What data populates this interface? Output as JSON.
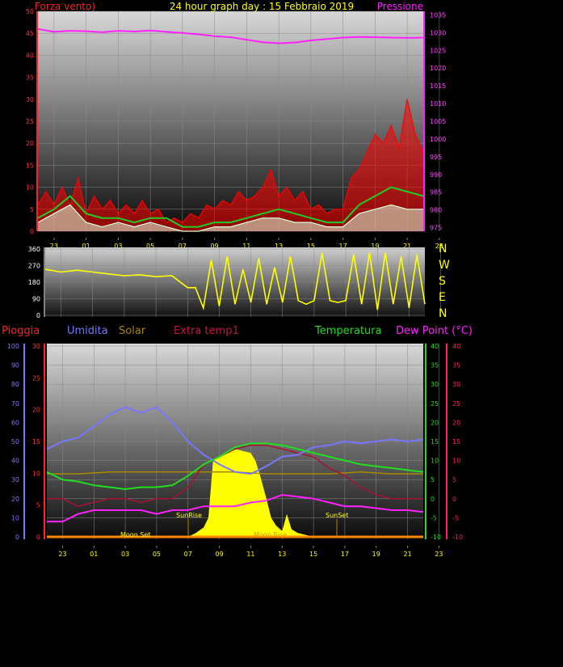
{
  "header": {
    "left_title": "Forza vento)",
    "center_title": "24 hour graph day : 15 Febbraio 2019",
    "right_title": "Pressione"
  },
  "compass": [
    "N",
    "W",
    "S",
    "E",
    "N"
  ],
  "legend": {
    "pioggia": "Pioggia",
    "umidita": "Umidita",
    "solar": "Solar",
    "extra": "Extra temp1",
    "temperatura": "Temperatura",
    "dewpoint": "Dew Point (°C)"
  },
  "annotations": {
    "sunrise": "SunRise",
    "sunset": "SunSet",
    "moonset": "Moon Set",
    "moonrise": "Moon Rise"
  },
  "colors": {
    "wind_gust": "#ff0000",
    "wind_avg": "#22cc22",
    "wind_speed": "#ddffdd",
    "pressure": "#ff22ff",
    "direction": "#ffff00",
    "humidity": "#7777ff",
    "temperature": "#22dd22",
    "dewpoint": "#ff22ff",
    "extra_temp": "#aa1133",
    "solar": "#ffff00",
    "solar_ref": "#aa8800",
    "rain": "#ff8800"
  },
  "chart_data": [
    {
      "type": "line",
      "name": "wind-pressure",
      "x_ticks": [
        "23",
        "01",
        "03",
        "05",
        "07",
        "09",
        "11",
        "13",
        "15",
        "17",
        "19",
        "21",
        "23"
      ],
      "y_left_ticks": [
        0,
        5,
        10,
        15,
        20,
        25,
        30,
        35,
        40,
        45,
        50
      ],
      "y_left_lim": [
        0,
        50
      ],
      "y_right_ticks": [
        975,
        980,
        985,
        990,
        995,
        1000,
        1005,
        1010,
        1015,
        1020,
        1025,
        1030,
        1035
      ],
      "y_right_lim": [
        974,
        1036
      ],
      "x_lim": [
        0,
        24
      ],
      "series": [
        {
          "key": "pressure",
          "axis": "right",
          "x": [
            0,
            1,
            2,
            3,
            4,
            5,
            6,
            7,
            8,
            9,
            10,
            11,
            12,
            13,
            14,
            15,
            16,
            17,
            18,
            19,
            20,
            21,
            22,
            23,
            24
          ],
          "values": [
            1031,
            1030.2,
            1030.5,
            1030.4,
            1030.1,
            1030.5,
            1030.3,
            1030.6,
            1030.2,
            1029.9,
            1029.5,
            1029,
            1028.7,
            1028,
            1027.3,
            1027,
            1027.2,
            1027.8,
            1028.2,
            1028.6,
            1028.8,
            1028.7,
            1028.6,
            1028.5,
            1028.6
          ]
        },
        {
          "key": "wind_gust",
          "axis": "left",
          "x": [
            0,
            0.5,
            1,
            1.5,
            2,
            2.5,
            3,
            3.5,
            4,
            4.5,
            5,
            5.5,
            6,
            6.5,
            7,
            7.5,
            8,
            8.5,
            9,
            9.5,
            10,
            10.5,
            11,
            11.5,
            12,
            12.5,
            13,
            13.5,
            14,
            14.5,
            15,
            15.5,
            16,
            16.5,
            17,
            17.5,
            18,
            18.5,
            19,
            19.5,
            20,
            20.5,
            21,
            21.5,
            22,
            22.5,
            23,
            23.5,
            24
          ],
          "values": [
            6,
            9,
            6,
            10,
            6,
            12,
            4,
            8,
            5,
            7,
            4,
            6,
            4,
            7,
            4,
            5,
            2,
            3,
            2,
            4,
            3,
            6,
            5,
            7,
            6,
            9,
            7,
            8,
            10,
            14,
            8,
            10,
            7,
            9,
            5,
            6,
            4,
            5,
            5,
            12,
            14,
            18,
            22,
            20,
            24,
            19,
            30,
            22,
            18
          ]
        },
        {
          "key": "wind_avg",
          "axis": "left",
          "x": [
            0,
            1,
            2,
            3,
            4,
            5,
            6,
            7,
            8,
            9,
            10,
            11,
            12,
            13,
            14,
            15,
            16,
            17,
            18,
            19,
            20,
            21,
            22,
            23,
            24
          ],
          "values": [
            3,
            5,
            8,
            4,
            3,
            3,
            2,
            3,
            3,
            1,
            1,
            2,
            2,
            3,
            4,
            5,
            4,
            3,
            2,
            2,
            6,
            8,
            10,
            9,
            8
          ]
        },
        {
          "key": "wind_speed",
          "axis": "left",
          "x": [
            0,
            1,
            2,
            3,
            4,
            5,
            6,
            7,
            8,
            9,
            10,
            11,
            12,
            13,
            14,
            15,
            16,
            17,
            18,
            19,
            20,
            21,
            22,
            23,
            24
          ],
          "values": [
            2,
            4,
            6,
            2,
            1,
            2,
            1,
            2,
            1,
            0,
            0,
            1,
            1,
            2,
            3,
            3,
            2,
            2,
            1,
            1,
            4,
            5,
            6,
            5,
            5
          ]
        }
      ]
    },
    {
      "type": "line",
      "name": "wind-direction",
      "x_ticks": [
        "23",
        "01",
        "03",
        "05",
        "07",
        "09",
        "11",
        "13",
        "15",
        "17",
        "19",
        "21",
        "23"
      ],
      "y_ticks": [
        0,
        90,
        180,
        270,
        360
      ],
      "y_lim": [
        0,
        360
      ],
      "x_lim": [
        0,
        24
      ],
      "series": [
        {
          "key": "direction",
          "x": [
            0,
            1,
            2,
            3,
            4,
            5,
            6,
            7,
            8,
            9,
            9.5,
            10,
            10.5,
            11,
            11.5,
            12,
            12.5,
            13,
            13.5,
            14,
            14.5,
            15,
            15.5,
            16,
            16.5,
            17,
            17.5,
            18,
            18.5,
            19,
            19.5,
            20,
            20.5,
            21,
            21.5,
            22,
            22.5,
            23,
            23.5,
            24
          ],
          "values": [
            250,
            235,
            245,
            235,
            225,
            215,
            220,
            210,
            215,
            150,
            150,
            40,
            300,
            50,
            320,
            60,
            250,
            70,
            310,
            60,
            260,
            70,
            320,
            80,
            60,
            80,
            340,
            80,
            70,
            80,
            330,
            60,
            340,
            30,
            340,
            60,
            320,
            40,
            330,
            60
          ]
        }
      ]
    },
    {
      "type": "line",
      "name": "weather-multi",
      "x_ticks": [
        "23",
        "01",
        "03",
        "05",
        "07",
        "09",
        "11",
        "13",
        "15",
        "17",
        "19",
        "21",
        "23"
      ],
      "y_left1_ticks": [
        0,
        10,
        20,
        30,
        40,
        50,
        60,
        70,
        80,
        90,
        100
      ],
      "y_left1_lim": [
        0,
        100
      ],
      "y_left2_ticks": [
        0,
        5,
        10,
        15,
        20,
        25,
        30
      ],
      "y_left2_lim": [
        0,
        30
      ],
      "y_right1_ticks": [
        -10,
        -5,
        0,
        5,
        10,
        15,
        20,
        25,
        30,
        35,
        40
      ],
      "y_right1_lim": [
        -10,
        40
      ],
      "y_right2_ticks": [
        -10,
        -5,
        0,
        5,
        10,
        15,
        20,
        25,
        30,
        35,
        40
      ],
      "y_right2_lim": [
        -10,
        40
      ],
      "x_lim": [
        0,
        24
      ],
      "series": [
        {
          "key": "humidity",
          "axis": "left1",
          "x": [
            0,
            1,
            2,
            3,
            4,
            5,
            6,
            7,
            8,
            9,
            10,
            11,
            12,
            13,
            14,
            15,
            16,
            17,
            18,
            19,
            20,
            21,
            22,
            23,
            24
          ],
          "values": [
            46,
            50,
            52,
            58,
            64,
            68,
            65,
            68,
            60,
            50,
            43,
            38,
            34,
            33,
            37,
            42,
            43,
            47,
            48,
            50,
            49,
            50,
            51,
            50,
            51
          ]
        },
        {
          "key": "temperature",
          "axis": "right1",
          "x": [
            0,
            1,
            2,
            3,
            4,
            5,
            6,
            7,
            8,
            9,
            10,
            11,
            12,
            13,
            14,
            15,
            16,
            17,
            18,
            19,
            20,
            21,
            22,
            23,
            24
          ],
          "values": [
            7,
            5,
            4.5,
            3.5,
            3,
            2.5,
            3,
            3,
            3.5,
            6,
            9,
            11,
            13.5,
            14.5,
            14.5,
            14,
            13,
            12,
            11,
            10,
            9,
            8.5,
            8,
            7.5,
            7
          ]
        },
        {
          "key": "dewpoint",
          "axis": "right1",
          "x": [
            0,
            1,
            2,
            3,
            4,
            5,
            6,
            7,
            8,
            9,
            10,
            11,
            12,
            13,
            14,
            15,
            16,
            17,
            18,
            19,
            20,
            21,
            22,
            23,
            24
          ],
          "values": [
            -6,
            -6,
            -4,
            -3,
            -3,
            -3,
            -3,
            -4,
            -3,
            -3,
            -2,
            -2,
            -2,
            -1,
            -0.5,
            1,
            0.5,
            0,
            -1,
            -2,
            -2,
            -2.5,
            -3,
            -3,
            -3.5
          ]
        },
        {
          "key": "extra_temp",
          "axis": "right1",
          "x": [
            0,
            1,
            2,
            3,
            4,
            5,
            6,
            7,
            8,
            9,
            10,
            11,
            12,
            13,
            14,
            15,
            16,
            17,
            18,
            19,
            20,
            21,
            22,
            23,
            24
          ],
          "values": [
            0,
            0,
            -2,
            -1,
            0,
            0,
            -1,
            0,
            0,
            3,
            9,
            11,
            13,
            14,
            14,
            13,
            12,
            11,
            8,
            6,
            3,
            1,
            0,
            0,
            0
          ]
        },
        {
          "key": "solar_ref",
          "axis": "right1",
          "x": [
            0,
            2,
            4,
            6,
            8,
            10,
            12,
            14,
            16,
            18,
            20,
            22,
            24
          ],
          "values": [
            6.5,
            6.5,
            7,
            7,
            7,
            7,
            7,
            6.5,
            6.5,
            6.5,
            7,
            6.5,
            6.5
          ]
        },
        {
          "key": "solar",
          "axis": "left1",
          "x": [
            9,
            9.5,
            10,
            10.3,
            10.6,
            11,
            11.5,
            12,
            12.5,
            13,
            13.3,
            13.6,
            14,
            14.3,
            14.6,
            15,
            15.3,
            15.6,
            16,
            16.5,
            17
          ],
          "values": [
            0,
            2,
            5,
            10,
            40,
            42,
            44,
            46,
            45,
            44,
            40,
            32,
            20,
            10,
            6,
            3,
            12,
            4,
            2,
            1,
            0
          ]
        },
        {
          "key": "rain",
          "axis": "left2",
          "x": [
            0,
            24
          ],
          "values": [
            0,
            0
          ]
        }
      ]
    }
  ]
}
